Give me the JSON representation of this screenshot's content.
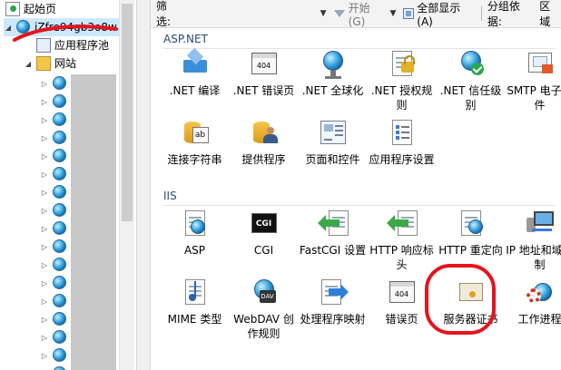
{
  "tree": {
    "start_page": "起始页",
    "server_node": "iZfre94gb3o8w",
    "app_pools": "应用程序池",
    "sites": "网站",
    "site_rows": 17
  },
  "filter_bar": {
    "filter_label": "筛选:",
    "start_label": "开始(G)",
    "show_all_label": "全部显示(A)",
    "group_by_label": "分组依据:",
    "group_by_value": "区域"
  },
  "sections": {
    "aspnet": "ASP.NET",
    "iis": "IIS"
  },
  "aspnet_features": [
    {
      "label": ".NET 编译",
      "icon": "boxes-icon"
    },
    {
      "label": ".NET 错误页",
      "icon": "error-404-icon"
    },
    {
      "label": ".NET 全球化",
      "icon": "globe-icon"
    },
    {
      "label": ".NET 授权规则",
      "icon": "lock-icon"
    },
    {
      "label": ".NET 信任级别",
      "icon": "trust-icon"
    },
    {
      "label": "SMTP 电子邮件",
      "icon": "mail-icon"
    },
    {
      "label": "连接字符串",
      "icon": "connection-string-icon"
    },
    {
      "label": "提供程序",
      "icon": "provider-icon"
    },
    {
      "label": "页面和控件",
      "icon": "page-controls-icon"
    },
    {
      "label": "应用程序设置",
      "icon": "app-settings-icon"
    }
  ],
  "iis_features": [
    {
      "label": "ASP",
      "icon": "asp-icon"
    },
    {
      "label": "CGI",
      "icon": "cgi-icon"
    },
    {
      "label": "FastCGI 设置",
      "icon": "fastcgi-icon"
    },
    {
      "label": "HTTP 响应标头",
      "icon": "http-headers-icon"
    },
    {
      "label": "HTTP 重定向",
      "icon": "http-redirect-icon"
    },
    {
      "label": "IP 地址和域限制",
      "icon": "ip-restrictions-icon"
    },
    {
      "label": "MIME 类型",
      "icon": "mime-icon"
    },
    {
      "label": "WebDAV 创作规则",
      "icon": "webdav-icon"
    },
    {
      "label": "处理程序映射",
      "icon": "handler-mappings-icon"
    },
    {
      "label": "错误页",
      "icon": "error-404-icon"
    },
    {
      "label": "服务器证书",
      "icon": "certificate-icon"
    },
    {
      "label": "工作进程",
      "icon": "worker-process-icon"
    }
  ],
  "colors": {
    "annotation_red": "#e5131c",
    "section_header": "#2b4a7a"
  }
}
